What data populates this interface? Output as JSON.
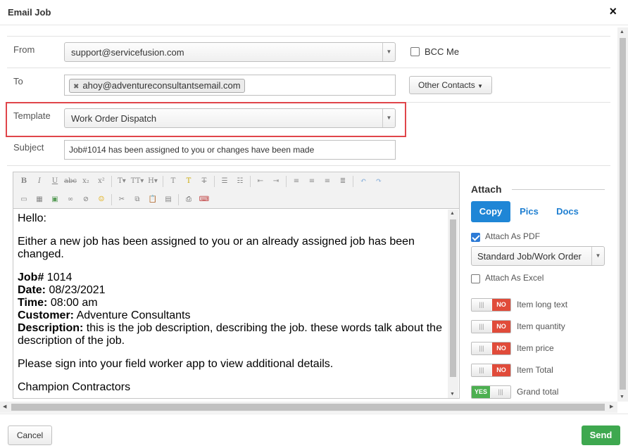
{
  "modal": {
    "title": "Email Job"
  },
  "form": {
    "from_label": "From",
    "from_value": "support@servicefusion.com",
    "bcc_label": "BCC Me",
    "to_label": "To",
    "to_recipient": "ahoy@adventureconsultantsemail.com",
    "other_contacts_label": "Other Contacts",
    "template_label": "Template",
    "template_value": "Work Order Dispatch",
    "subject_label": "Subject",
    "subject_value": "Job#1014 has been assigned to you or changes have been made"
  },
  "body": {
    "greeting": "Hello:",
    "intro": "Either a new job has been assigned to you or an already assigned job has been changed.",
    "job_label": "Job#",
    "job_value": " 1014",
    "date_label": "Date:",
    "date_value": " 08/23/2021",
    "time_label": "Time:",
    "time_value": " 08:00 am",
    "customer_label": "Customer:",
    "customer_value": " Adventure Consultants",
    "description_label": "Description:",
    "description_value": " this is the job description, describing the job. these words talk about the description of the job.",
    "signin": "Please sign into your field worker app to view additional details.",
    "signature": "Champion Contractors"
  },
  "attach": {
    "title": "Attach",
    "tabs": [
      "Copy",
      "Pics",
      "Docs"
    ],
    "active_tab": "Copy",
    "attach_pdf_label": "Attach As PDF",
    "attach_pdf_checked": true,
    "pdf_format_value": "Standard Job/Work Order",
    "attach_excel_label": "Attach As Excel",
    "attach_excel_checked": false,
    "toggles": [
      {
        "label": "Item long text",
        "state": "NO"
      },
      {
        "label": "Item quantity",
        "state": "NO"
      },
      {
        "label": "Item price",
        "state": "NO"
      },
      {
        "label": "Item Total",
        "state": "NO"
      },
      {
        "label": "Grand total",
        "state": "YES"
      }
    ]
  },
  "footer": {
    "cancel_label": "Cancel",
    "send_label": "Send"
  },
  "colors": {
    "primary": "#1f86d6",
    "send": "#3ea84f",
    "no": "#e04b3a",
    "yes": "#4caf50",
    "highlight": "#e0454a"
  }
}
